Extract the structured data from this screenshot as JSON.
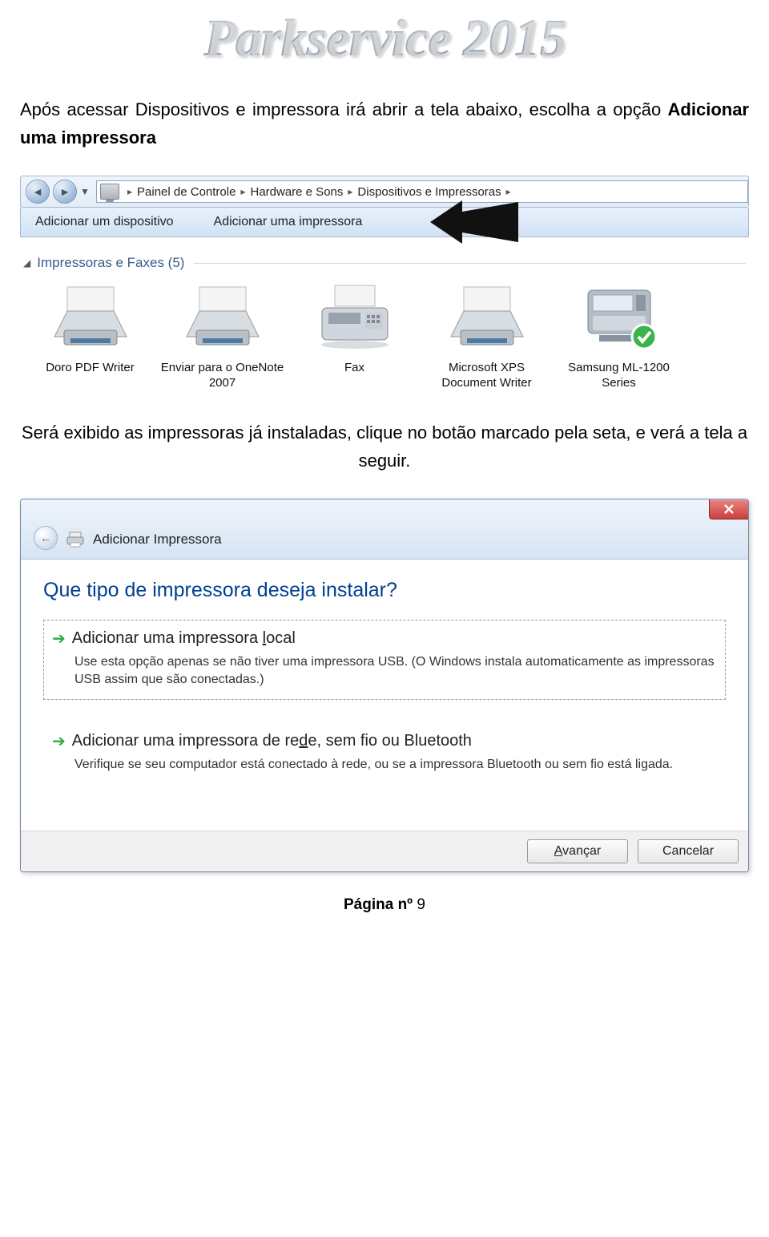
{
  "logo": "Parkservice 2015",
  "intro": {
    "text_a": "Após acessar Dispositivos e impressora irá abrir a tela abaixo, escolha a opção ",
    "text_b": "Adicionar uma impressora"
  },
  "explorer": {
    "crumbs": [
      "Painel de Controle",
      "Hardware e Sons",
      "Dispositivos e Impressoras"
    ],
    "menu": [
      "Adicionar um dispositivo",
      "Adicionar uma impressora"
    ],
    "section_title": "Impressoras e Faxes (5)",
    "printers": [
      {
        "name": "Doro PDF Writer"
      },
      {
        "name": "Enviar para o OneNote 2007"
      },
      {
        "name": "Fax"
      },
      {
        "name": "Microsoft XPS Document Writer"
      },
      {
        "name": "Samsung ML-1200 Series",
        "default": true
      }
    ]
  },
  "mid_text": "Será exibido as impressoras já instaladas, clique no botão marcado pela seta, e verá a tela a seguir.",
  "wizard": {
    "title": "Adicionar Impressora",
    "question": "Que tipo de impressora deseja instalar?",
    "opt1_pre": "Adicionar uma impressora ",
    "opt1_u": "l",
    "opt1_post": "ocal",
    "opt1_desc": "Use esta opção apenas se não tiver uma impressora USB. (O Windows instala automaticamente as impressoras USB assim que são conectadas.)",
    "opt2_pre": "Adicionar uma impressora de re",
    "opt2_u": "d",
    "opt2_post": "e, sem fio ou Bluetooth",
    "opt2_desc": "Verifique se seu computador está conectado à rede, ou se a impressora Bluetooth ou sem fio está ligada.",
    "btn_next_u": "A",
    "btn_next_rest": "vançar",
    "btn_cancel": "Cancelar"
  },
  "footer_a": "Página nº ",
  "footer_b": "9"
}
